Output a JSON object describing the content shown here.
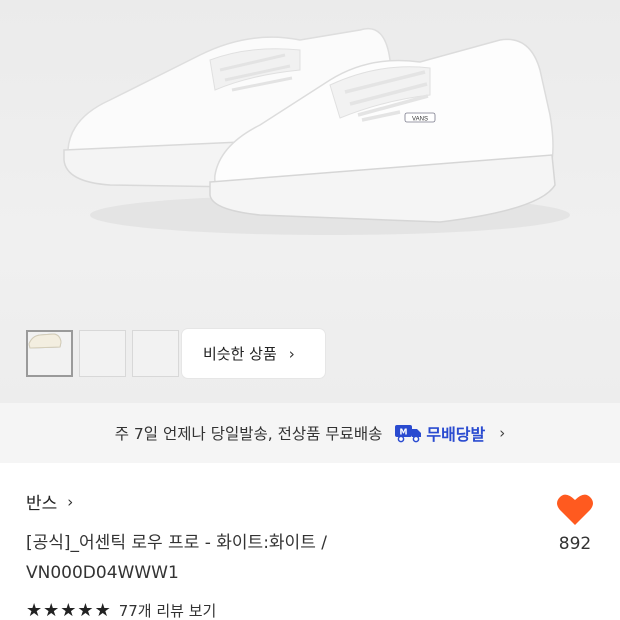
{
  "thumbnails": [
    {
      "name": "thumb-white-shoe-1",
      "active": true
    },
    {
      "name": "thumb-white-shoe-2",
      "active": false
    },
    {
      "name": "thumb-cream-shoe",
      "active": false
    }
  ],
  "similar_products": {
    "label": "비슷한 상품",
    "chevron": "›"
  },
  "delivery": {
    "text": "주 7일 언제나 당일발송, 전상품 무료배송",
    "service_name": "무배당발",
    "icon": "truck-icon",
    "badge_letter": "M",
    "chevron": "›"
  },
  "product": {
    "brand": "반스",
    "brand_chevron": "›",
    "title_line1": "[공식]_어센틱 로우 프로 - 화이트:화이트 /",
    "title_line2": "VN000D04WWW1"
  },
  "like": {
    "count": "892",
    "icon": "heart-icon",
    "color": "#ff5a1f"
  },
  "rating": {
    "stars": 5,
    "star_glyph": "★",
    "review_text": "77개 리뷰 보기"
  },
  "shoe_logo": "VANS"
}
